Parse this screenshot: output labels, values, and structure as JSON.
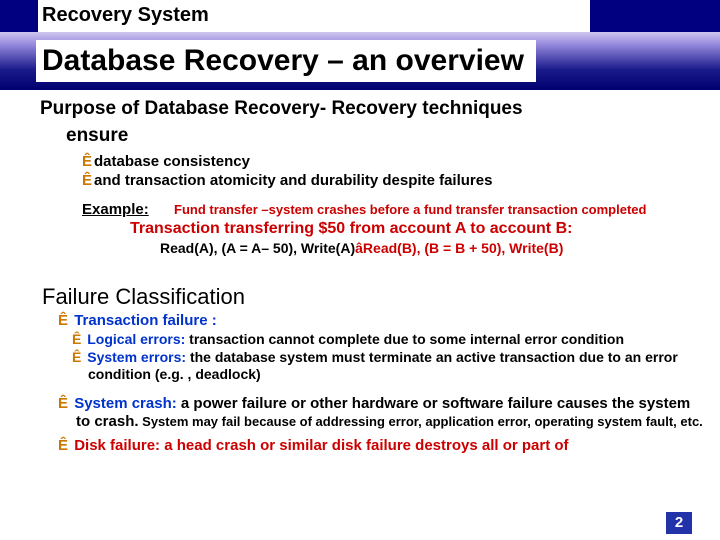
{
  "header": {
    "topic": "Recovery System"
  },
  "title": "Database Recovery – an overview",
  "purpose": {
    "line1": "Purpose of Database Recovery- Recovery techniques",
    "line2": "ensure",
    "bullet1": "database consistency",
    "bullet2": "and transaction atomicity and durability despite failures"
  },
  "example": {
    "label": "Example:",
    "desc": "Fund transfer –system crashes before a fund transfer transaction completed",
    "transfer": "Transaction transferring $50 from account A to account B:",
    "rw_a": "Read(A), (A = A– 50), Write(A)",
    "rw_b": "Read(B), (B = B + 50), Write(B)"
  },
  "failure": {
    "heading": "Failure Classification",
    "txn_label": "Transaction failure :",
    "logical_label": "Logical errors:",
    "logical_desc": " transaction cannot complete due to some internal error condition",
    "system_label": "System errors:",
    "system_desc": " the database system must terminate an active transaction due to an error condition (e.g. , deadlock)",
    "crash_label": "System crash:",
    "crash_desc1": " a power failure or other hardware or software failure causes the system to crash.",
    "crash_desc2": " System may fail because of addressing error, application error, operating system fault, etc.",
    "disk_label": "Disk failure:",
    "disk_desc": " a head crash or similar disk failure destroys all or part of"
  },
  "page_number": "2",
  "glyphs": {
    "arrow": "Ê",
    "down_arrow": "â"
  }
}
